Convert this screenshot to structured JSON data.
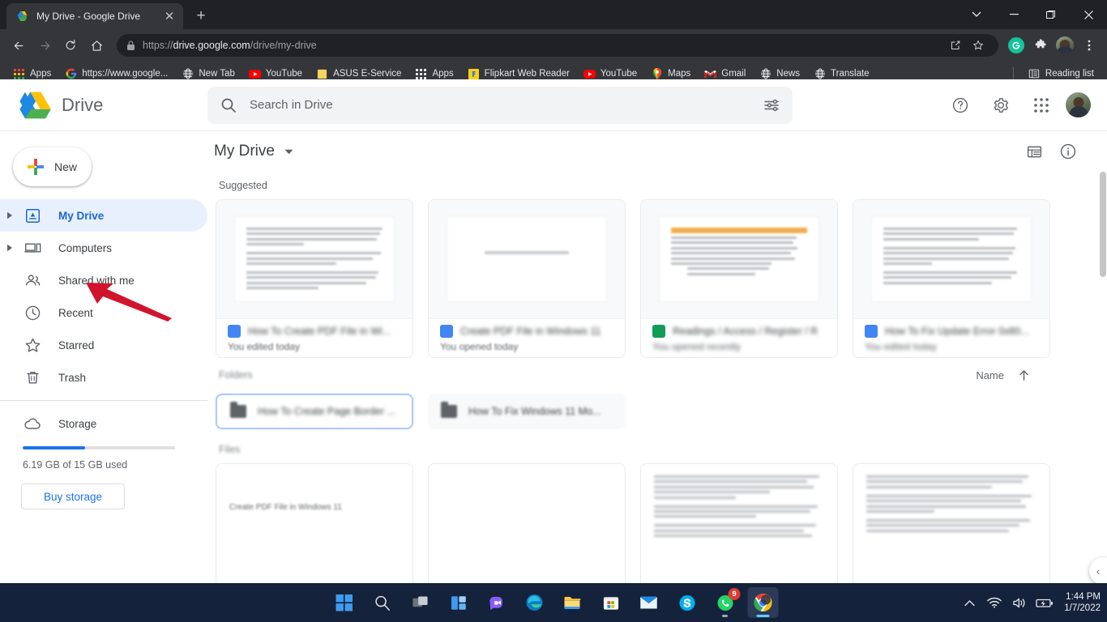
{
  "browser": {
    "tab": {
      "title": "My Drive - Google Drive",
      "favicon": "google-drive-icon",
      "close": "✕"
    },
    "new_tab_label": "+",
    "window_controls": {
      "minimize_list": "⌄",
      "minimize": "—",
      "maximize": "❐",
      "close": "✕"
    },
    "nav": {
      "back": "←",
      "forward": "→",
      "reload": "⟳",
      "home": "⌂"
    },
    "omnibox": {
      "scheme": "https://",
      "domain": "drive.google.com",
      "path": "/drive/my-drive",
      "lock_icon": "lock-icon",
      "share_icon": "share-icon",
      "star_icon": "star-icon"
    },
    "toolbar_icons": [
      "grammarly-icon",
      "extensions-icon",
      "profile-avatar",
      "chrome-menu-icon"
    ],
    "bookmarks": [
      {
        "label": "Apps",
        "icon": "apps-grid-icon"
      },
      {
        "label": "https://www.google...",
        "icon": "google-icon"
      },
      {
        "label": "New Tab",
        "icon": "globe-icon"
      },
      {
        "label": "YouTube",
        "icon": "youtube-icon"
      },
      {
        "label": "ASUS E-Service",
        "icon": "folder-icon"
      },
      {
        "label": "Apps",
        "icon": "apps-grid-icon"
      },
      {
        "label": "Flipkart Web Reader",
        "icon": "flipkart-icon"
      },
      {
        "label": "YouTube",
        "icon": "youtube-icon"
      },
      {
        "label": "Maps",
        "icon": "maps-pin-icon"
      },
      {
        "label": "Gmail",
        "icon": "gmail-icon"
      },
      {
        "label": "News",
        "icon": "globe-icon"
      },
      {
        "label": "Translate",
        "icon": "globe-icon"
      }
    ],
    "reading_list": {
      "label": "Reading list",
      "icon": "reading-list-icon"
    }
  },
  "drive": {
    "brand": "Drive",
    "search": {
      "placeholder": "Search in Drive",
      "search_icon": "search-icon",
      "options_icon": "search-options-icon"
    },
    "header_icons": [
      {
        "name": "help-icon",
        "glyph": "?"
      },
      {
        "name": "settings-gear-icon",
        "glyph": "⚙"
      },
      {
        "name": "google-apps-icon",
        "glyph": "apps"
      }
    ],
    "new_button": {
      "label": "New",
      "icon": "plus-icon"
    },
    "nav_items": [
      {
        "label": "My Drive",
        "icon": "my-drive-icon",
        "expandable": true,
        "active": true
      },
      {
        "label": "Computers",
        "icon": "computers-icon",
        "expandable": true,
        "active": false
      },
      {
        "label": "Shared with me",
        "icon": "shared-people-icon",
        "expandable": false,
        "active": false
      },
      {
        "label": "Recent",
        "icon": "clock-icon",
        "expandable": false,
        "active": false
      },
      {
        "label": "Starred",
        "icon": "star-outline-icon",
        "expandable": false,
        "active": false
      },
      {
        "label": "Trash",
        "icon": "trash-icon",
        "expandable": false,
        "active": false
      }
    ],
    "storage": {
      "label": "Storage",
      "icon": "cloud-icon",
      "used_text": "6.19 GB of 15 GB used",
      "percent": 41,
      "buy_label": "Buy storage"
    },
    "breadcrumb": {
      "label": "My Drive",
      "caret": "▾"
    },
    "view_icons": [
      {
        "name": "list-view-icon"
      },
      {
        "name": "details-info-icon"
      }
    ],
    "sections": {
      "suggested": "Suggested",
      "folders": "Folders",
      "files": "Files"
    },
    "sort": {
      "label": "Name",
      "direction_icon": "arrow-up-icon"
    },
    "suggested_cards": [
      {
        "name": "How To Create PDF File in Wi...",
        "subtitle": "You edited today",
        "type": "doc"
      },
      {
        "name": "Create PDF File in Windows 11",
        "subtitle": "You opened today",
        "type": "doc"
      },
      {
        "name": "Readings / Access / Register / Rev...",
        "subtitle": "You opened recently",
        "type": "sheet"
      },
      {
        "name": "How To Fix Update Error 0x80...",
        "subtitle": "You edited today",
        "type": "doc"
      }
    ],
    "folders": [
      {
        "name": "How To Create Page Border ...",
        "selected": true
      },
      {
        "name": "How To Fix Windows 11 Mo...",
        "selected": false
      }
    ],
    "files": [
      {
        "title": "Create PDF File in Windows 11"
      },
      {
        "title": ""
      },
      {
        "title": ""
      },
      {
        "title": ""
      }
    ],
    "expand_chip": {
      "icon": "chevron-left-icon",
      "glyph": "‹"
    }
  },
  "taskbar": {
    "apps": [
      {
        "name": "start-button",
        "label": "Start"
      },
      {
        "name": "search-taskbar-icon",
        "label": "Search"
      },
      {
        "name": "task-view-icon",
        "label": "Task View"
      },
      {
        "name": "widgets-icon",
        "label": "Widgets"
      },
      {
        "name": "teams-chat-icon",
        "label": "Chat"
      },
      {
        "name": "microsoft-edge-icon",
        "label": "Microsoft Edge"
      },
      {
        "name": "file-explorer-icon",
        "label": "File Explorer"
      },
      {
        "name": "microsoft-store-icon",
        "label": "Microsoft Store"
      },
      {
        "name": "mail-icon",
        "label": "Mail"
      },
      {
        "name": "skype-icon",
        "label": "Skype"
      },
      {
        "name": "whatsapp-icon",
        "label": "WhatsApp",
        "badge": "9"
      },
      {
        "name": "google-chrome-icon",
        "label": "Google Chrome",
        "active": true
      }
    ],
    "tray": {
      "chevron": "⌃",
      "wifi_icon": "wifi-icon",
      "volume_icon": "volume-icon",
      "battery_icon": "battery-charging-icon",
      "time": "1:44 PM",
      "date": "1/7/2022"
    }
  }
}
